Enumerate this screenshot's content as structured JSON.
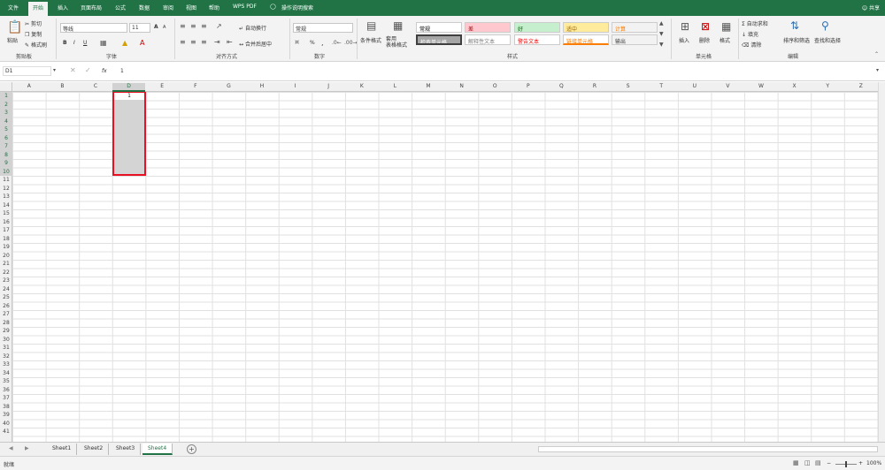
{
  "menu": {
    "items": [
      "文件",
      "开始",
      "插入",
      "页面布局",
      "公式",
      "数据",
      "审阅",
      "视图",
      "帮助",
      "WPS PDF"
    ],
    "active_index": 1,
    "tell_me": "操作说明搜索",
    "share": "共享"
  },
  "ribbon": {
    "clipboard": {
      "paste": "粘贴",
      "cut": "剪切",
      "copy": "复制",
      "format_painter": "格式刷",
      "label": "剪贴板"
    },
    "font": {
      "name": "等线",
      "size": "11",
      "bold": "B",
      "italic": "I",
      "underline": "U",
      "grow": "A",
      "shrink": "A",
      "label": "字体"
    },
    "alignment": {
      "wrap": "自动换行",
      "merge": "合并后居中",
      "label": "对齐方式"
    },
    "number": {
      "format": "常规",
      "percent": "%",
      "comma": ",",
      "label": "数字"
    },
    "styles": {
      "conditional": "条件格式",
      "table_format": "套用\n表格格式",
      "cells": [
        {
          "text": "常规",
          "bg": "#ffffff",
          "fg": "#000000"
        },
        {
          "text": "差",
          "bg": "#ffc7ce",
          "fg": "#9c0006"
        },
        {
          "text": "好",
          "bg": "#c6efce",
          "fg": "#006100"
        },
        {
          "text": "适中",
          "bg": "#ffeb9c",
          "fg": "#9c6500"
        },
        {
          "text": "计算",
          "bg": "#f2f2f2",
          "fg": "#fa7d00"
        },
        {
          "text": "检查单元格",
          "bg": "#a5a5a5",
          "fg": "#ffffff"
        },
        {
          "text": "解释性文本",
          "bg": "#ffffff",
          "fg": "#7f7f7f"
        },
        {
          "text": "警告文本",
          "bg": "#ffffff",
          "fg": "#ff0000"
        },
        {
          "text": "链接单元格",
          "bg": "#ffffff",
          "fg": "#fa7d00"
        },
        {
          "text": "输出",
          "bg": "#f2f2f2",
          "fg": "#3f3f3f"
        }
      ],
      "label": "样式"
    },
    "cells_group": {
      "insert": "插入",
      "delete": "删除",
      "format": "格式",
      "label": "单元格"
    },
    "editing": {
      "autosum": "自动求和",
      "fill": "填充",
      "clear": "清除",
      "sort": "排序和筛选",
      "find": "查找和选择",
      "label": "编辑"
    }
  },
  "formula_bar": {
    "name_box": "D1",
    "fx": "fx",
    "value": "1"
  },
  "grid": {
    "columns": [
      "A",
      "B",
      "C",
      "D",
      "E",
      "F",
      "G",
      "H",
      "I",
      "J",
      "K",
      "L",
      "M",
      "N",
      "O",
      "P",
      "Q",
      "R",
      "S",
      "T",
      "U",
      "V",
      "W",
      "X",
      "Y",
      "Z"
    ],
    "rows": [
      "1",
      "2",
      "3",
      "4",
      "5",
      "6",
      "7",
      "8",
      "9",
      "10",
      "11",
      "12",
      "13",
      "14",
      "15",
      "16",
      "17",
      "18",
      "19",
      "20",
      "21",
      "22",
      "23",
      "24",
      "25",
      "26",
      "27",
      "28",
      "29",
      "30",
      "31",
      "32",
      "33",
      "34",
      "35",
      "36",
      "37",
      "38",
      "39",
      "40",
      "41"
    ],
    "active_cell_value": "1"
  },
  "sheets": {
    "tabs": [
      "Sheet1",
      "Sheet2",
      "Sheet3",
      "Sheet4"
    ],
    "active_index": 3,
    "add": "+"
  },
  "status": {
    "ready": "就绪",
    "zoom": "100%"
  },
  "colors": {
    "accent": "#217346",
    "selection": "#d4d4d4",
    "selection_border": "#e81123"
  }
}
